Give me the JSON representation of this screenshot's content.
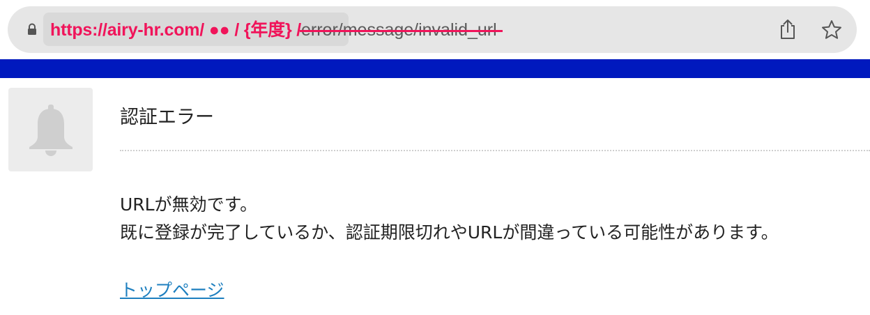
{
  "browser": {
    "url_annotation": "https://airy-hr.com/ ●● / {年度} /",
    "url_struck": "error/message/invalid_url",
    "annotation_color": "#f0145a"
  },
  "header": {
    "band_color": "#0019be"
  },
  "notice": {
    "icon": "bell-icon",
    "title": "認証エラー",
    "message_lines": [
      "URLが無効です。",
      "既に登録が完了しているか、認証期限切れやURLが間違っている可能性があります。"
    ],
    "link_label": "トップページ",
    "link_color": "#1d7fbf"
  }
}
